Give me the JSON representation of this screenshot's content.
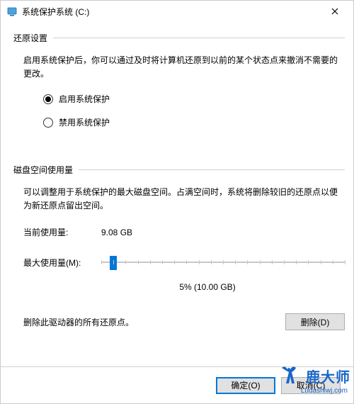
{
  "window": {
    "title": "系统保护系统 (C:)"
  },
  "restore": {
    "section_title": "还原设置",
    "description": "启用系统保护后，你可以通过及时将计算机还原到以前的某个状态点来撤消不需要的更改。",
    "option_enable": "启用系统保护",
    "option_disable": "禁用系统保护",
    "selected": "enable"
  },
  "disk": {
    "section_title": "磁盘空间使用量",
    "description": "可以调整用于系统保护的最大磁盘空间。占满空间时，系统将删除较旧的还原点以便为新还原点留出空间。",
    "current_label": "当前使用量:",
    "current_value": "9.08 GB",
    "max_label": "最大使用量(M):",
    "slider_percent": 5,
    "slider_caption": "5% (10.00 GB)",
    "delete_text": "删除此驱动器的所有还原点。",
    "delete_button": "删除(D)"
  },
  "buttons": {
    "ok": "确定(O)",
    "cancel": "取消(C)"
  },
  "watermark": {
    "title": "鹿大师",
    "url": "Ludashiwj.com"
  }
}
